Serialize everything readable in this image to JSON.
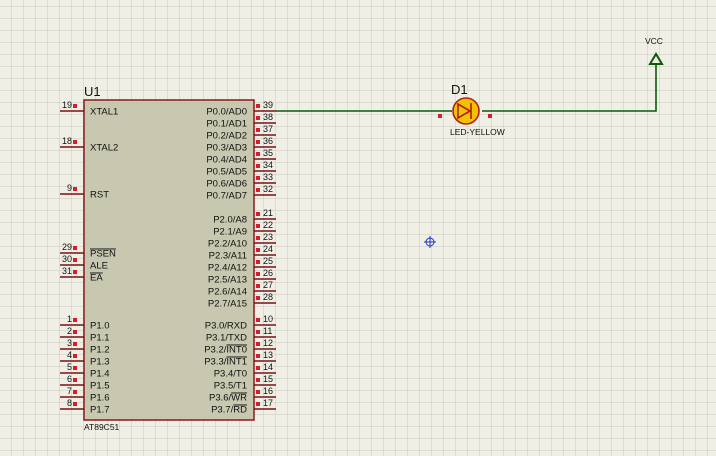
{
  "colors": {
    "background": "#f0efe6",
    "grid": "#c9c9bd",
    "chip_fill": "#c8c8b0",
    "chip_border": "#8b1a1a",
    "pin_line": "#7a1010",
    "pin_square": "#d21f2b",
    "wire": "#0b5a0b",
    "led_fill": "#f2c400",
    "led_stroke": "#b21d1d",
    "vcc_arrow": "#0b5a0b"
  },
  "chip": {
    "ref": "U1",
    "part": "AT89C51",
    "left_pins": [
      {
        "num": "19",
        "name": "XTAL1"
      },
      {
        "num": "18",
        "name": "XTAL2"
      },
      {
        "num": "9",
        "name": "RST"
      },
      {
        "num": "29",
        "name": "PSEN",
        "overline": true
      },
      {
        "num": "30",
        "name": "ALE"
      },
      {
        "num": "31",
        "name": "EA",
        "overline": true
      },
      {
        "num": "1",
        "name": "P1.0"
      },
      {
        "num": "2",
        "name": "P1.1"
      },
      {
        "num": "3",
        "name": "P1.2"
      },
      {
        "num": "4",
        "name": "P1.3"
      },
      {
        "num": "5",
        "name": "P1.4"
      },
      {
        "num": "6",
        "name": "P1.5"
      },
      {
        "num": "7",
        "name": "P1.6"
      },
      {
        "num": "8",
        "name": "P1.7"
      }
    ],
    "right_pins": [
      {
        "num": "39",
        "name": "P0.0/AD0"
      },
      {
        "num": "38",
        "name": "P0.1/AD1"
      },
      {
        "num": "37",
        "name": "P0.2/AD2"
      },
      {
        "num": "36",
        "name": "P0.3/AD3"
      },
      {
        "num": "35",
        "name": "P0.4/AD4"
      },
      {
        "num": "34",
        "name": "P0.5/AD5"
      },
      {
        "num": "33",
        "name": "P0.6/AD6"
      },
      {
        "num": "32",
        "name": "P0.7/AD7"
      },
      {
        "num": "21",
        "name": "P2.0/A8"
      },
      {
        "num": "22",
        "name": "P2.1/A9"
      },
      {
        "num": "23",
        "name": "P2.2/A10"
      },
      {
        "num": "24",
        "name": "P2.3/A11"
      },
      {
        "num": "25",
        "name": "P2.4/A12"
      },
      {
        "num": "26",
        "name": "P2.5/A13"
      },
      {
        "num": "27",
        "name": "P2.6/A14"
      },
      {
        "num": "28",
        "name": "P2.7/A15"
      },
      {
        "num": "10",
        "name": "P3.0/RXD"
      },
      {
        "num": "11",
        "name": "P3.1/TXD"
      },
      {
        "num": "12",
        "name": "P3.2/",
        "over_suffix": "INT0"
      },
      {
        "num": "13",
        "name": "P3.3/",
        "over_suffix": "INT1"
      },
      {
        "num": "14",
        "name": "P3.4/T0"
      },
      {
        "num": "15",
        "name": "P3.5/T1"
      },
      {
        "num": "16",
        "name": "P3.6/",
        "over_suffix": "WR"
      },
      {
        "num": "17",
        "name": "P3.7/",
        "over_suffix": "RD"
      }
    ]
  },
  "led": {
    "ref": "D1",
    "value": "LED-YELLOW"
  },
  "power": {
    "label": "VCC"
  }
}
